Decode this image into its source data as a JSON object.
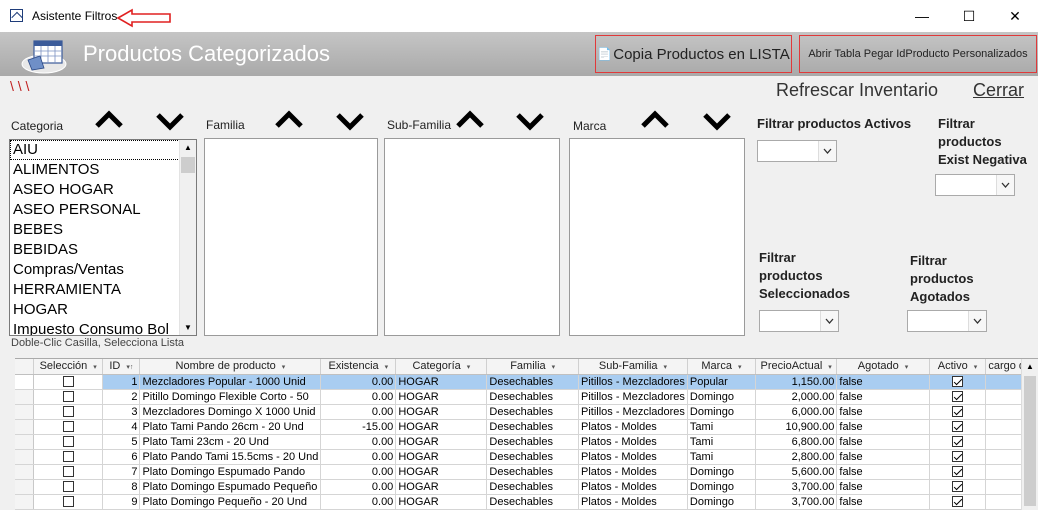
{
  "window": {
    "title": "Asistente Filtros",
    "minimize": "—",
    "maximize": "☐",
    "close": "✕"
  },
  "header": {
    "page_title": "Productos Categorizados",
    "copy_button": "Copia Productos en LISTA",
    "open_table_button": "Abrir Tabla Pegar IdProducto Personalizados"
  },
  "toolbar": {
    "slashes": "\\ \\ \\",
    "refresh": "Refrescar Inventario",
    "close": "Cerrar"
  },
  "filters": {
    "categoria_label": "Categoria",
    "familia_label": "Familia",
    "subfamilia_label": "Sub-Familia",
    "marca_label": "Marca",
    "categorias": [
      "AIU",
      "ALIMENTOS",
      "ASEO HOGAR",
      "ASEO PERSONAL",
      "BEBES",
      "BEBIDAS",
      "Compras/Ventas",
      "HERRAMIENTA",
      "HOGAR",
      "Impuesto Consumo Bol"
    ],
    "activos_label": "Filtrar productos Activos",
    "negativa_label_1": "Filtrar",
    "negativa_label_2": "productos",
    "negativa_label_3": "Exist Negativa",
    "seleccionados_label_1": "Filtrar",
    "seleccionados_label_2": "productos",
    "seleccionados_label_3": "Seleccionados",
    "agotados_label_1": "Filtrar",
    "agotados_label_2": "productos",
    "agotados_label_3": "Agotados",
    "hint": "Doble-Clic Casilla, Selecciona Lista"
  },
  "grid": {
    "columns": [
      "Selección",
      "ID",
      "Nombre de producto",
      "Existencia",
      "Categoría",
      "Familia",
      "Sub-Familia",
      "Marca",
      "PrecioActual",
      "Agotado",
      "Activo",
      "cargo de"
    ],
    "rows": [
      {
        "id": "1",
        "nombre": "Mezcladores Popular - 1000 Unid",
        "existencia": "0.00",
        "categoria": "HOGAR",
        "familia": "Desechables",
        "subfamilia": "Pitillos - Mezcladores",
        "marca": "Popular",
        "precio": "1,150.00",
        "agotado": "false"
      },
      {
        "id": "2",
        "nombre": "Pitillo Domingo Flexible Corto - 50",
        "existencia": "0.00",
        "categoria": "HOGAR",
        "familia": "Desechables",
        "subfamilia": "Pitillos - Mezcladores",
        "marca": "Domingo",
        "precio": "2,000.00",
        "agotado": "false"
      },
      {
        "id": "3",
        "nombre": "Mezcladores Domingo X 1000 Unid",
        "existencia": "0.00",
        "categoria": "HOGAR",
        "familia": "Desechables",
        "subfamilia": "Pitillos - Mezcladores",
        "marca": "Domingo",
        "precio": "6,000.00",
        "agotado": "false"
      },
      {
        "id": "4",
        "nombre": "Plato Tami Pando 26cm - 20 Und",
        "existencia": "-15.00",
        "categoria": "HOGAR",
        "familia": "Desechables",
        "subfamilia": "Platos - Moldes",
        "marca": "Tami",
        "precio": "10,900.00",
        "agotado": "false"
      },
      {
        "id": "5",
        "nombre": "Plato Tami 23cm - 20 Und",
        "existencia": "0.00",
        "categoria": "HOGAR",
        "familia": "Desechables",
        "subfamilia": "Platos - Moldes",
        "marca": "Tami",
        "precio": "6,800.00",
        "agotado": "false"
      },
      {
        "id": "6",
        "nombre": "Plato Pando Tami 15.5cms - 20 Und",
        "existencia": "0.00",
        "categoria": "HOGAR",
        "familia": "Desechables",
        "subfamilia": "Platos - Moldes",
        "marca": "Tami",
        "precio": "2,800.00",
        "agotado": "false"
      },
      {
        "id": "7",
        "nombre": "Plato Domingo Espumado Pando",
        "existencia": "0.00",
        "categoria": "HOGAR",
        "familia": "Desechables",
        "subfamilia": "Platos - Moldes",
        "marca": "Domingo",
        "precio": "5,600.00",
        "agotado": "false"
      },
      {
        "id": "8",
        "nombre": "Plato Domingo Espumado Pequeño",
        "existencia": "0.00",
        "categoria": "HOGAR",
        "familia": "Desechables",
        "subfamilia": "Platos - Moldes",
        "marca": "Domingo",
        "precio": "3,700.00",
        "agotado": "false"
      },
      {
        "id": "9",
        "nombre": "Plato Domingo Pequeño - 20 Und",
        "existencia": "0.00",
        "categoria": "HOGAR",
        "familia": "Desechables",
        "subfamilia": "Platos - Moldes",
        "marca": "Domingo",
        "precio": "3,700.00",
        "agotado": "false"
      }
    ]
  }
}
